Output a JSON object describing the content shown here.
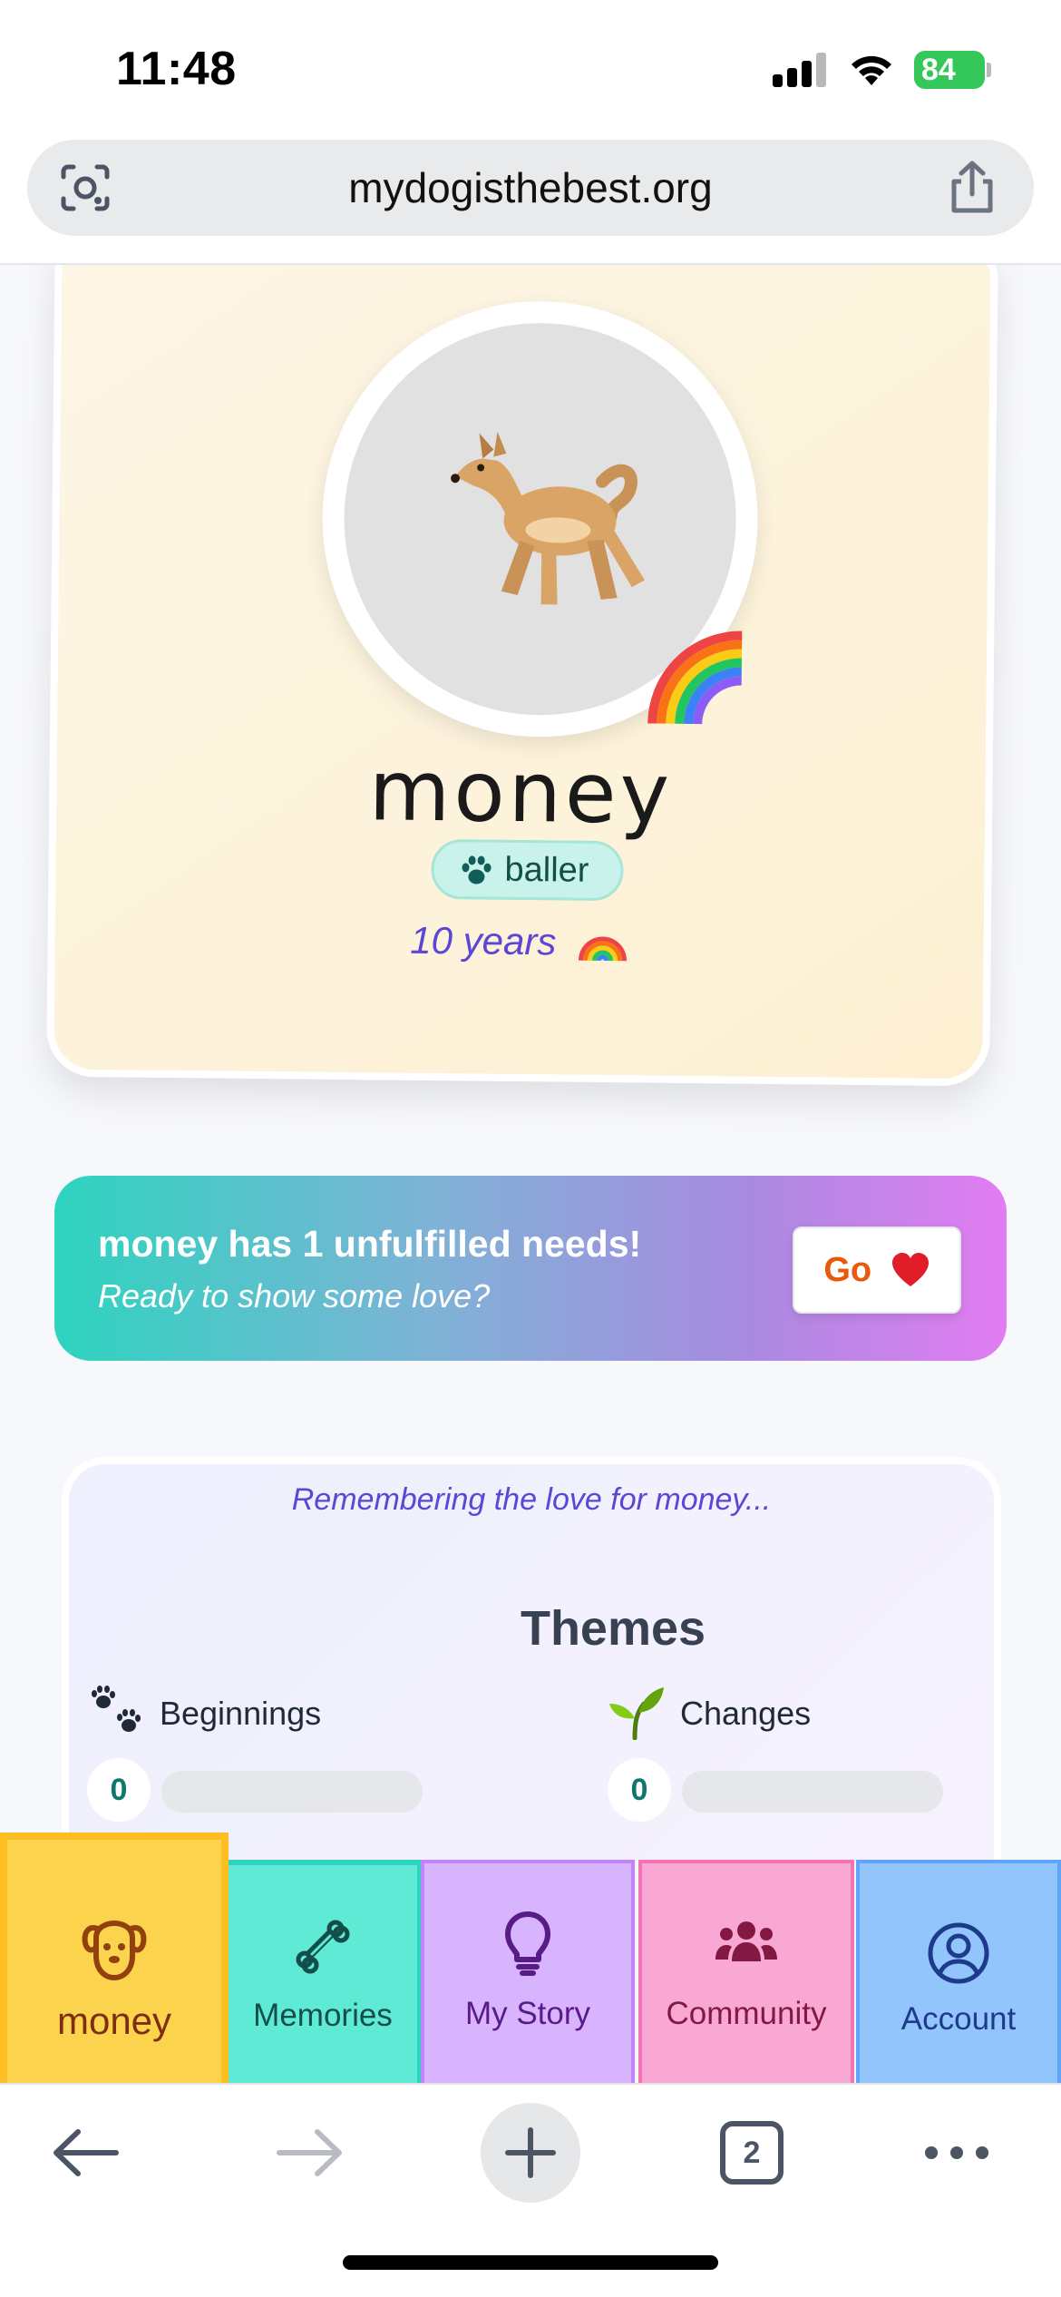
{
  "status_bar": {
    "time": "11:48",
    "battery": "84"
  },
  "browser": {
    "url": "mydogisthebest.org",
    "tab_count": "2"
  },
  "profile": {
    "name": "money",
    "breed": "baller",
    "age": "10 years"
  },
  "needs_banner": {
    "title": "money has 1 unfulfilled needs!",
    "subtitle": "Ready to show some love?",
    "button_label": "Go"
  },
  "themes": {
    "remember_text": "Remembering the love for money...",
    "heading": "Themes",
    "items": [
      {
        "label": "Beginnings",
        "count": "0",
        "emoji": "paw-prints-emoji"
      },
      {
        "label": "Changes",
        "count": "0",
        "emoji": "seedling-emoji"
      }
    ]
  },
  "tab_bar": {
    "items": [
      {
        "label": "money",
        "icon": "dog-face-icon"
      },
      {
        "label": "Memories",
        "icon": "bone-icon"
      },
      {
        "label": "My Story",
        "icon": "lightbulb-icon"
      },
      {
        "label": "Community",
        "icon": "users-icon"
      },
      {
        "label": "Account",
        "icon": "user-circle-icon"
      }
    ]
  },
  "colors": {
    "accent_purple": "#5b46d6",
    "tab_money": "#fcd34d",
    "tab_memories": "#5eead4",
    "tab_story": "#d8b4fe",
    "tab_community": "#f9a8d4",
    "tab_account": "#93c5fd",
    "go_text": "#ea580c"
  }
}
